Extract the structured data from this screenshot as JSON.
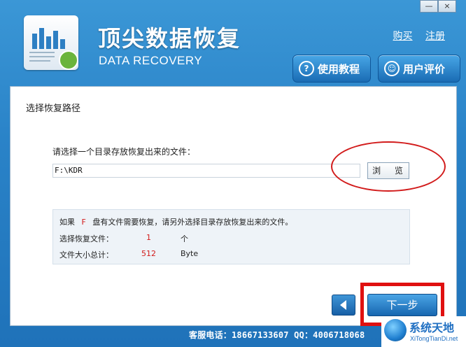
{
  "window": {
    "minimize_glyph": "—",
    "close_glyph": "×"
  },
  "header": {
    "title_cn": "顶尖数据恢复",
    "title_en": "DATA RECOVERY",
    "links": {
      "buy": "购买",
      "register": "注册"
    },
    "tabs": {
      "tutorial": "使用教程",
      "review": "用户评价"
    },
    "icons": {
      "tutorial": "question-icon",
      "review": "user-review-icon"
    }
  },
  "content": {
    "section_title": "选择恢复路径",
    "prompt": "请选择一个目录存放恢复出来的文件：",
    "path_value": "F:\\KDR",
    "browse_label": "浏 览",
    "info": {
      "line1_prefix": "如果",
      "drive_letter": "F",
      "line1_suffix": "盘有文件需要恢复，请另外选择目录存放恢复出来的文件。",
      "files_label": "选择恢复文件：",
      "files_count": "1",
      "files_unit": "个",
      "size_label": "文件大小总计：",
      "size_value": "512",
      "size_unit": "Byte"
    },
    "next_label": "下一步"
  },
  "footer": {
    "contact": "客服电话：18667133607 QQ：4006718068"
  },
  "watermark": {
    "cn": "系统天地",
    "en": "XiTongTianDi.net"
  },
  "colors": {
    "accent_blue": "#2a83c8",
    "annotation_red": "#d21b1b"
  }
}
